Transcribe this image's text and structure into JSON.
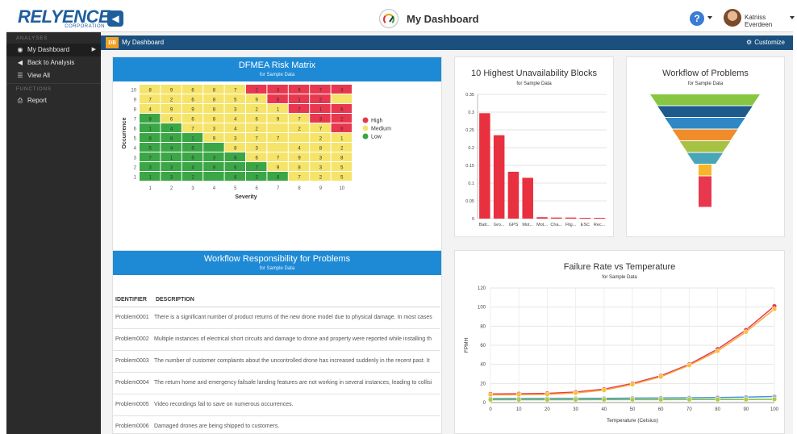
{
  "header": {
    "logo_text": "RELYENCE",
    "logo_sub": "CORPORATION",
    "dashboard_title": "My Dashboard",
    "user_name": "Katniss Everdeen",
    "help_glyph": "?",
    "collapse_glyph": "◀"
  },
  "sidebar": {
    "sections": [
      {
        "title": "ANALYSES",
        "items": [
          {
            "label": "My Dashboard",
            "icon": "dashboard-icon",
            "active": true,
            "has_arrow": true
          },
          {
            "label": "Back to Analysis",
            "icon": "caret-left-icon",
            "active": false,
            "has_arrow": false
          },
          {
            "label": "View All",
            "icon": "list-icon",
            "active": false,
            "has_arrow": false
          }
        ]
      },
      {
        "title": "FUNCTIONS",
        "items": [
          {
            "label": "Report",
            "icon": "print-icon",
            "active": false,
            "has_arrow": false
          }
        ]
      }
    ]
  },
  "mainbar": {
    "badge": "DB",
    "title": "My Dashboard",
    "customize_label": "Customize"
  },
  "colors": {
    "high": "#e8384f",
    "medium": "#f6e46a",
    "low": "#3ba646",
    "accent": "#1e8ad6",
    "navbar": "#1a4f7e",
    "bar": "#e8303f"
  },
  "risk_matrix": {
    "title": "DFMEA Risk Matrix",
    "subtitle": "for Sample Data",
    "xlabel": "Severity",
    "ylabel": "Occurrence",
    "x_ticks": [
      "1",
      "2",
      "3",
      "4",
      "5",
      "6",
      "7",
      "8",
      "9",
      "10"
    ],
    "y_ticks": [
      "10",
      "9",
      "8",
      "7",
      "6",
      "5",
      "4",
      "3",
      "2",
      "1"
    ],
    "legend": [
      {
        "label": "High",
        "level": "high"
      },
      {
        "label": "Medium",
        "level": "medium"
      },
      {
        "label": "Low",
        "level": "low"
      }
    ],
    "levels": [
      [
        "medium",
        "medium",
        "medium",
        "medium",
        "medium",
        "high",
        "high",
        "high",
        "high",
        "high"
      ],
      [
        "medium",
        "medium",
        "medium",
        "medium",
        "medium",
        "medium",
        "high",
        "high",
        "high",
        "medium"
      ],
      [
        "medium",
        "medium",
        "medium",
        "medium",
        "medium",
        "medium",
        "medium",
        "high",
        "high",
        "high"
      ],
      [
        "low",
        "medium",
        "medium",
        "medium",
        "medium",
        "medium",
        "medium",
        "medium",
        "high",
        "high"
      ],
      [
        "low",
        "low",
        "medium",
        "medium",
        "medium",
        "medium",
        "medium",
        "medium",
        "medium",
        "high"
      ],
      [
        "low",
        "low",
        "low",
        "medium",
        "medium",
        "medium",
        "medium",
        "medium",
        "medium",
        "medium"
      ],
      [
        "low",
        "low",
        "low",
        "low",
        "medium",
        "medium",
        "medium",
        "medium",
        "medium",
        "medium"
      ],
      [
        "low",
        "low",
        "low",
        "low",
        "low",
        "medium",
        "medium",
        "medium",
        "medium",
        "medium"
      ],
      [
        "low",
        "low",
        "low",
        "low",
        "low",
        "low",
        "medium",
        "medium",
        "medium",
        "medium"
      ],
      [
        "low",
        "low",
        "low",
        "low",
        "low",
        "low",
        "low",
        "medium",
        "medium",
        "medium"
      ]
    ],
    "counts": [
      [
        "8",
        "9",
        "6",
        "8",
        "7",
        "2",
        "3",
        "6",
        "7",
        "3"
      ],
      [
        "7",
        "2",
        "6",
        "8",
        "5",
        "9",
        "8",
        "1",
        "2",
        ""
      ],
      [
        "4",
        "9",
        "9",
        "8",
        "3",
        "2",
        "1",
        "7",
        "1",
        "6"
      ],
      [
        "8",
        "6",
        "6",
        "8",
        "4",
        "6",
        "9",
        "7",
        "3",
        "2"
      ],
      [
        "1",
        "4",
        "7",
        "3",
        "4",
        "2",
        "",
        "2",
        "7",
        "8"
      ],
      [
        "8",
        "8",
        "1",
        "9",
        "3",
        "7",
        "7",
        "",
        "2",
        "1"
      ],
      [
        "5",
        "4",
        "6",
        "",
        "8",
        "3",
        "",
        "4",
        "8",
        "2"
      ],
      [
        "7",
        "1",
        "6",
        "3",
        "8",
        "6",
        "7",
        "9",
        "3",
        "8"
      ],
      [
        "3",
        "3",
        "4",
        "9",
        "6",
        "7",
        "9",
        "8",
        "3",
        "5"
      ],
      [
        "1",
        "3",
        "2",
        "",
        "8",
        "3",
        "8",
        "7",
        "2",
        "5"
      ]
    ]
  },
  "unavailability": {
    "title": "10 Highest Unavailability Blocks",
    "subtitle": "for Sample Data",
    "chart_data": {
      "type": "bar",
      "categories": [
        "Batt...",
        "Gro...",
        "GPS",
        "Mot...",
        "Mot...",
        "Cha...",
        "Flig...",
        "ESC",
        "Rec..."
      ],
      "values": [
        0.297,
        0.235,
        0.132,
        0.115,
        0.004,
        0.003,
        0.003,
        0.002,
        0.002
      ],
      "ylim": [
        0,
        0.35
      ],
      "y_ticks": [
        "0",
        "0.05",
        "0.1",
        "0.15",
        "0.2",
        "0.25",
        "0.3",
        "0.35"
      ],
      "y_tick_values": [
        0,
        0.05,
        0.1,
        0.15,
        0.2,
        0.25,
        0.3,
        0.35
      ]
    }
  },
  "funnel": {
    "title": "Workflow of Problems",
    "subtitle": "for Sample Data",
    "stages": [
      {
        "color": "#86c640"
      },
      {
        "color": "#1e5a8c"
      },
      {
        "color": "#2f87c6"
      },
      {
        "color": "#f18c2a"
      },
      {
        "color": "#a7c143"
      },
      {
        "color": "#49a6b8"
      },
      {
        "color": "#f7b529"
      },
      {
        "color": "#e8384f"
      }
    ]
  },
  "workflow": {
    "title": "Workflow Responsibility for Problems",
    "subtitle": "for Sample Data",
    "columns": [
      "IDENTIFIER",
      "DESCRIPTION"
    ],
    "rows": [
      {
        "id": "Problem0001",
        "desc": "There is a significant number of product returns of the new drone model due to physical damage. In most cases"
      },
      {
        "id": "Problem0002",
        "desc": "Multiple instances of electrical short circuits and damage to drone and property were reported while installing th"
      },
      {
        "id": "Problem0003",
        "desc": "The number of customer complaints about the uncontrolled drone has increased suddenly in the recent past. It"
      },
      {
        "id": "Problem0004",
        "desc": "The return home and emergency failsafe landing features are not working in several instances, leading to collisi"
      },
      {
        "id": "Problem0005",
        "desc": "Video recordings fail to save on numerous occurrences."
      },
      {
        "id": "Problem0006",
        "desc": "Damaged drones are being shipped to customers."
      }
    ]
  },
  "failure_rate": {
    "title": "Failure Rate vs Temperature",
    "subtitle": "for Sample Data",
    "chart_data": {
      "type": "line",
      "xlabel": "Temperature (Celsius)",
      "ylabel": "FPMH",
      "x": [
        0,
        10,
        20,
        30,
        40,
        50,
        60,
        70,
        80,
        90,
        100
      ],
      "xlim": [
        0,
        100
      ],
      "ylim": [
        0,
        120
      ],
      "x_ticks": [
        "0",
        "10",
        "20",
        "30",
        "40",
        "50",
        "60",
        "70",
        "80",
        "90",
        "100"
      ],
      "y_ticks": [
        "0",
        "20",
        "40",
        "60",
        "80",
        "100",
        "120"
      ],
      "y_tick_values": [
        0,
        20,
        40,
        60,
        80,
        100,
        120
      ],
      "series": [
        {
          "color": "#e8384f",
          "marker": "#e8384f",
          "values": [
            9,
            9.2,
            9.6,
            11,
            14,
            20,
            28,
            40,
            56,
            76,
            101
          ]
        },
        {
          "color": "#f6a83a",
          "marker": "#f6c13a",
          "values": [
            8,
            8.2,
            8.6,
            10,
            13,
            19,
            27,
            39,
            54,
            74,
            98
          ]
        },
        {
          "color": "#4a90d9",
          "marker": "#9ab7dc",
          "values": [
            4,
            4.1,
            4.2,
            4.3,
            4.4,
            4.6,
            4.8,
            5.0,
            5.3,
            5.7,
            6.3
          ]
        },
        {
          "color": "#7bc043",
          "marker": "#b5c93a",
          "values": [
            3,
            3.0,
            3.0,
            3.0,
            3.1,
            3.1,
            3.1,
            3.2,
            3.2,
            3.3,
            3.4
          ]
        }
      ]
    }
  }
}
